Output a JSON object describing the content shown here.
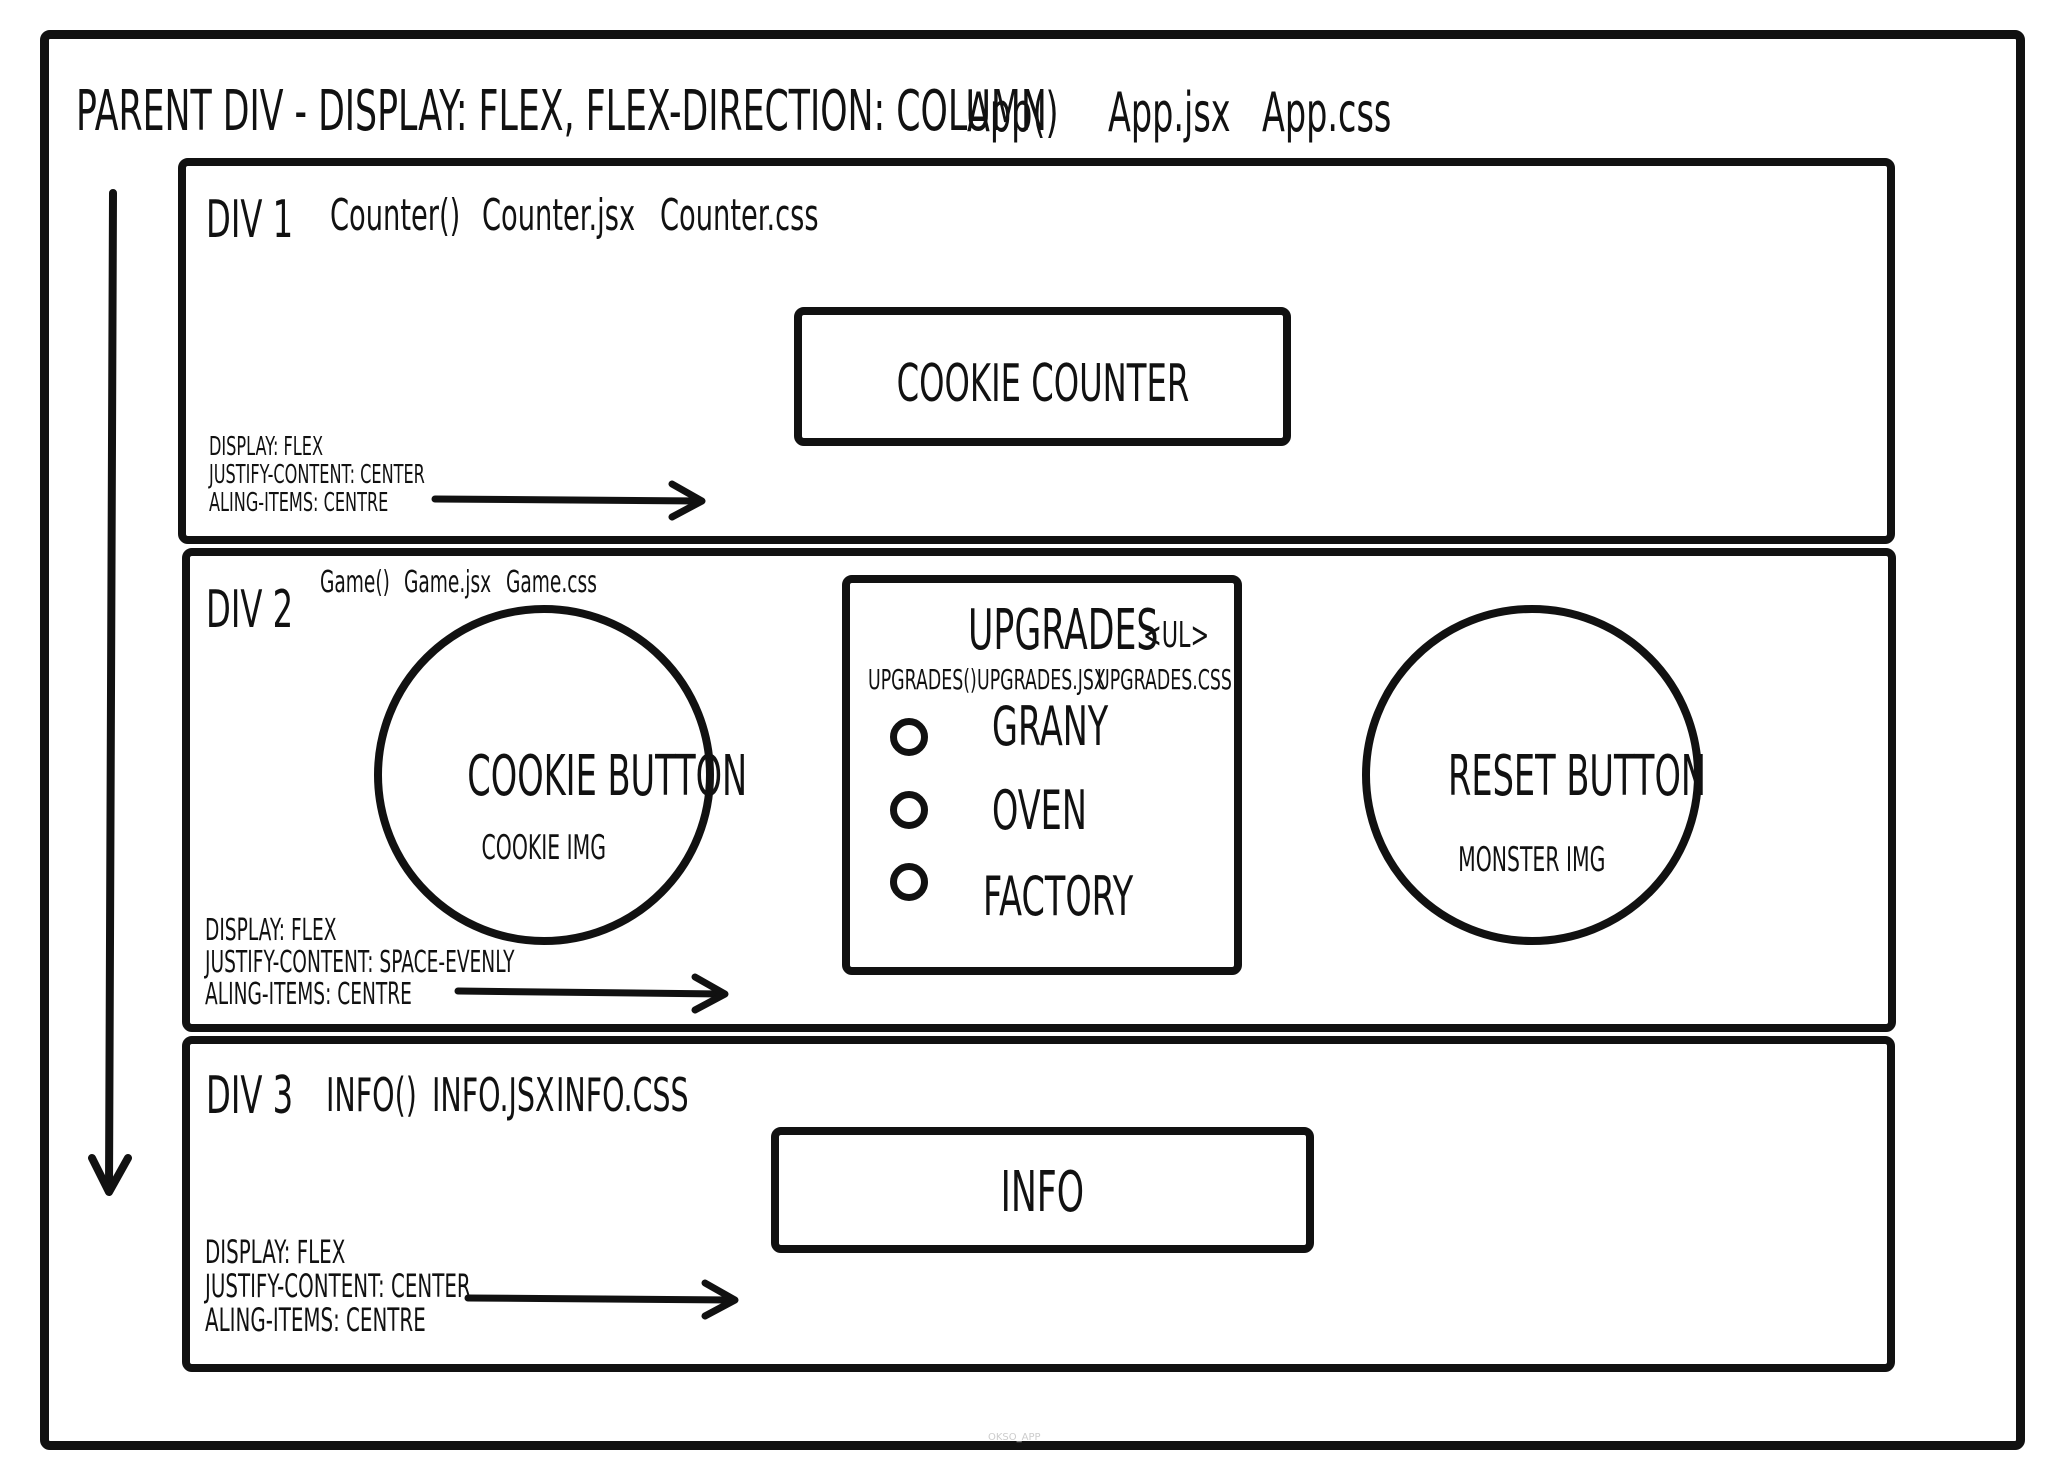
{
  "parent": {
    "title": "PARENT DIV - DISPLAY: FLEX, FLEX-DIRECTION: COLUMN",
    "component": "App()",
    "jsx": "App.jsx",
    "css": "App.css"
  },
  "div1": {
    "label": "DIV 1",
    "component": "Counter()",
    "jsx": "Counter.jsx",
    "css": "Counter.css",
    "box_label": "COOKIE COUNTER",
    "styles": [
      "DISPLAY: FLEX",
      "JUSTIFY-CONTENT: CENTER",
      "ALING-ITEMS: CENTRE"
    ]
  },
  "div2": {
    "label": "DIV 2",
    "component": "Game()",
    "jsx": "Game.jsx",
    "css": "Game.css",
    "cookie_button": {
      "label": "COOKIE BUTTON",
      "sub": "COOKIE IMG"
    },
    "upgrades": {
      "title": "UPGRADES",
      "tag": "<UL>",
      "component": "UPGRADES()",
      "jsx": "UPGRADES.JSX",
      "css": "UPGRADES.CSS",
      "items": [
        "GRANY",
        "OVEN",
        "FACTORY"
      ]
    },
    "reset_button": {
      "label": "RESET BUTTON",
      "sub": "MONSTER IMG"
    },
    "styles": [
      "DISPLAY: FLEX",
      "JUSTIFY-CONTENT: SPACE-EVENLY",
      "ALING-ITEMS: CENTRE"
    ]
  },
  "div3": {
    "label": "DIV 3",
    "component": "INFO()",
    "jsx": "INFO.JSX",
    "css": "INFO.CSS",
    "box_label": "INFO",
    "styles": [
      "DISPLAY: FLEX",
      "JUSTIFY-CONTENT: CENTER",
      "ALING-ITEMS: CENTRE"
    ]
  },
  "watermark": "OKSO_APP"
}
